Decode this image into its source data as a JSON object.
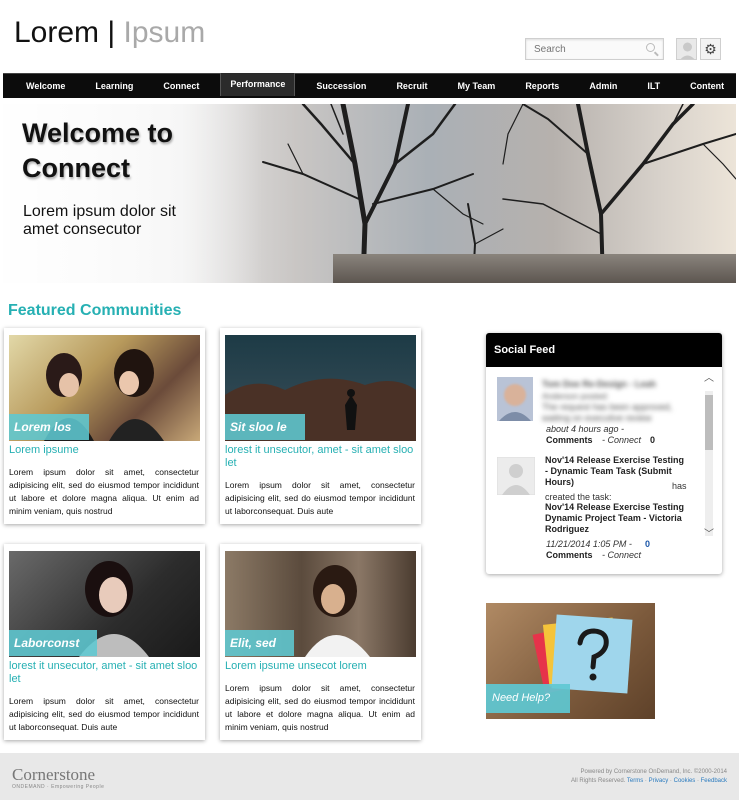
{
  "header": {
    "logo_primary": "Lorem",
    "logo_separator": "|",
    "logo_secondary": "Ipsum",
    "search_placeholder": "Search",
    "gear_glyph": "⚙"
  },
  "nav": {
    "items": [
      "Welcome",
      "Learning",
      "Connect",
      "Performance",
      "Succession",
      "Recruit",
      "My Team",
      "Reports",
      "Admin",
      "ILT",
      "Content"
    ],
    "active": "Performance"
  },
  "hero": {
    "title": "Welcome to Connect",
    "subtitle": "Lorem ipsum dolor sit amet consecutor"
  },
  "featured": {
    "title": "Featured Communities",
    "cards": [
      {
        "tag": "Lorem los",
        "subtitle": "Lorem ipsume",
        "body": "Lorem ipsum dolor sit amet, consectetur adipisicing elit, sed do eiusmod tempor incididunt ut labore et dolore magna aliqua. Ut enim ad minim veniam, quis nostrud"
      },
      {
        "tag": "Sit sloo le",
        "subtitle": "lorest it unsecutor, amet - sit amet sloo let",
        "body": "Lorem ipsum dolor sit amet, consectetur adipisicing elit, sed do eiusmod tempor incididunt ut laborconsequat. Duis aute"
      },
      {
        "tag": "Laborconst",
        "subtitle": "lorest it unsecutor, amet - sit amet sloo let",
        "body": "Lorem ipsum dolor sit amet, consectetur adipisicing elit, sed do eiusmod tempor incididunt ut laborconsequat. Duis aute"
      },
      {
        "tag": "Elit, sed",
        "subtitle": "Lorem ipsume unsecot lorem",
        "body": "Lorem ipsum dolor sit amet, consectetur adipisicing elit, sed do eiusmod tempor incididunt ut labore et dolore magna aliqua. Ut enim ad minim veniam, quis nostrud"
      }
    ]
  },
  "social_feed": {
    "title": "Social Feed",
    "entries": [
      {
        "name": "Tom Doe Re-Design - Leah",
        "line2": "Anderson posted:",
        "text_blurred": "The request has been approved, waiting on executive review",
        "time": "about 4 hours ago -",
        "comments_label": "Comments",
        "source": "- Connect",
        "count": "0"
      },
      {
        "title": "Nov'14 Release Exercise Testing - Dynamic Team Task (Submit Hours)",
        "has": "has",
        "created": "created the task:",
        "task": "Nov'14 Release Exercise Testing Dynamic Project Team - Victoria Rodriguez",
        "time": "11/21/2014 1:05 PM -",
        "count": "0",
        "comments_label": "Comments",
        "source": "- Connect"
      }
    ]
  },
  "help": {
    "label": "Need Help?"
  },
  "footer": {
    "brand": "Cornerstone",
    "tagline": "ONDEMAND · Empowering People",
    "powered": "Powered by Cornerstone OnDemand, Inc. ©2000-2014",
    "rights": "All Rights Reserved.",
    "links": [
      "Terms",
      "Privacy",
      "Cookies",
      "Feedback"
    ]
  },
  "colors": {
    "accent": "#26b0b3",
    "nav_bg": "#0c0c0c",
    "tag_bg": "#5ec8d2",
    "footer_bg": "#e8e8e8"
  }
}
